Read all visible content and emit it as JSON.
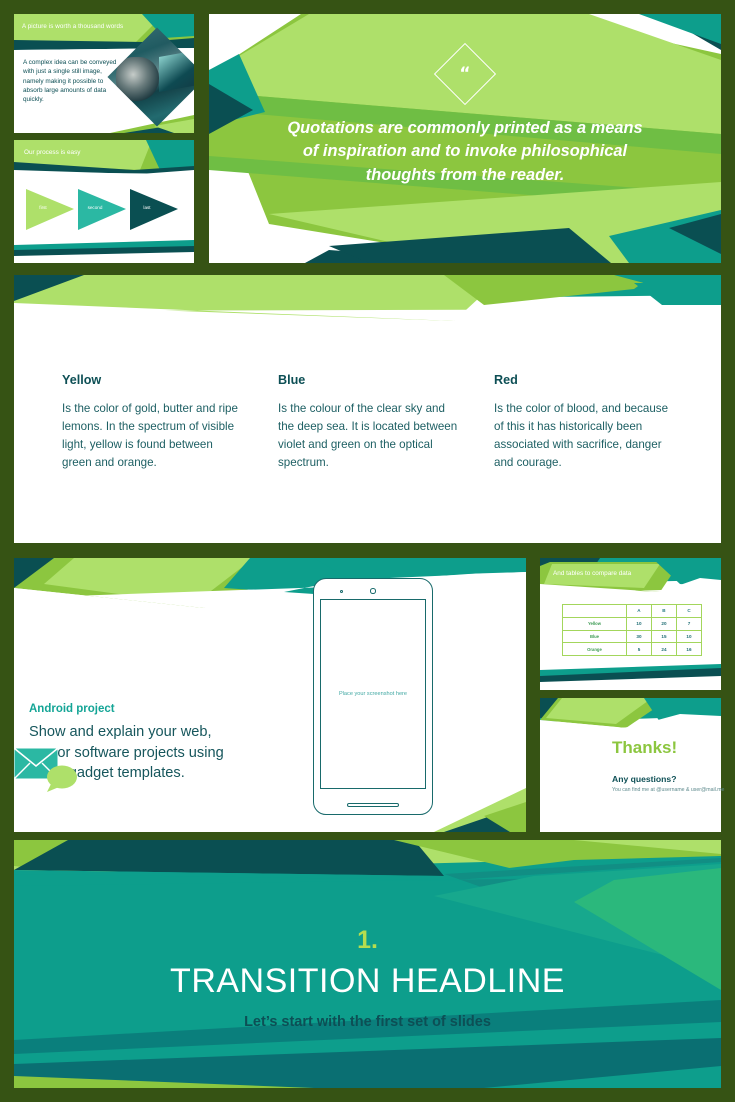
{
  "palette": {
    "canvas_border": "#365314",
    "light_green": "#aee06a",
    "mid_green": "#8cc63f",
    "teal": "#0d9e8c",
    "dark_teal": "#0a4f52",
    "deep_navy_teal": "#0d4f55",
    "white": "#ffffff"
  },
  "slides": {
    "picture": {
      "header": "A picture is worth a thousand words",
      "body": "A complex idea can be conveyed with just a single still image, namely making it possible to absorb large amounts of data quickly.",
      "image_caption": "diamond-cropped-photo"
    },
    "process": {
      "header": "Our process is easy",
      "steps": [
        {
          "label": "first",
          "color": "#aee06a"
        },
        {
          "label": "second",
          "color": "#2bb8a3"
        },
        {
          "label": "last",
          "color": "#0a4f52"
        }
      ]
    },
    "quotation": {
      "icon": "quote-mark",
      "text": "Quotations are commonly printed as a means of inspiration and to invoke philosophical thoughts from the reader."
    },
    "columns": [
      {
        "title": "Yellow",
        "body": "Is the color of gold, butter and ripe lemons. In the spectrum of visible light, yellow is found between green and orange."
      },
      {
        "title": "Blue",
        "body": "Is the colour of the clear sky and the deep sea. It is located between violet and green on the optical spectrum."
      },
      {
        "title": "Red",
        "body": "Is the color of blood, and because of this it has historically been associated with sacrifice, danger and courage."
      }
    ],
    "android": {
      "eyebrow": "Android project",
      "body": "Show and explain your web, app or software projects using these gadget templates.",
      "phone_placeholder": "Place your screenshot here"
    },
    "table": {
      "header": "And tables to compare data",
      "columns": [
        "",
        "A",
        "B",
        "C"
      ],
      "rows": [
        {
          "label": "Yellow",
          "values": [
            "10",
            "20",
            "7"
          ]
        },
        {
          "label": "Blue",
          "values": [
            "30",
            "15",
            "10"
          ]
        },
        {
          "label": "Orange",
          "values": [
            "5",
            "24",
            "16"
          ]
        }
      ]
    },
    "thanks": {
      "title": "Thanks!",
      "subtitle": "Any questions?",
      "contact": "You can find me at @username & user@mail.me",
      "icons": [
        "envelope-icon",
        "speech-bubble-icon"
      ]
    },
    "transition": {
      "number": "1.",
      "headline": "TRANSITION HEADLINE",
      "subtitle": "Let’s start with the first set of slides"
    }
  }
}
